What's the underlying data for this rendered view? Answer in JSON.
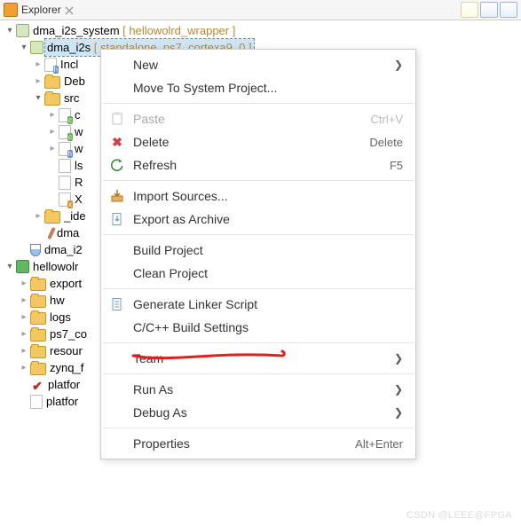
{
  "tab": {
    "title": "Explorer"
  },
  "tree": {
    "root1": {
      "label": "dma_i2s_system",
      "suffix": " [ hellowolrd_wrapper ]",
      "child": {
        "label": "dma_i2s",
        "suffix": " [ standalone_ps7_cortexa9_0 ]",
        "children": {
          "incl": "Incl",
          "deb": "Deb",
          "src": "src",
          "src_c": "c",
          "src_w1": "w",
          "src_w2": "w",
          "src_ls": "ls",
          "src_r": "R",
          "src_x": "X",
          "ide": "_ide",
          "dma1": "dma",
          "dma2": "dma_i2"
        }
      }
    },
    "root2": {
      "label": "hellowolr",
      "children": {
        "export": "export",
        "hw": "hw",
        "logs": "logs",
        "ps7": "ps7_co",
        "resour": "resour",
        "zynq": "zynq_f",
        "platfor1": "platfor",
        "platfor2": "platfor"
      }
    }
  },
  "menu": {
    "new": "New",
    "move": "Move To System Project...",
    "paste": "Paste",
    "paste_sc": "Ctrl+V",
    "delete": "Delete",
    "delete_sc": "Delete",
    "refresh": "Refresh",
    "refresh_sc": "F5",
    "import": "Import Sources...",
    "export": "Export as Archive",
    "build": "Build Project",
    "clean": "Clean Project",
    "linker": "Generate Linker Script",
    "ccbuild": "C/C++ Build Settings",
    "team": "Team",
    "run": "Run As",
    "debug": "Debug As",
    "props": "Properties",
    "props_sc": "Alt+Enter"
  },
  "watermark": "CSDN @LEEE@FPGA"
}
